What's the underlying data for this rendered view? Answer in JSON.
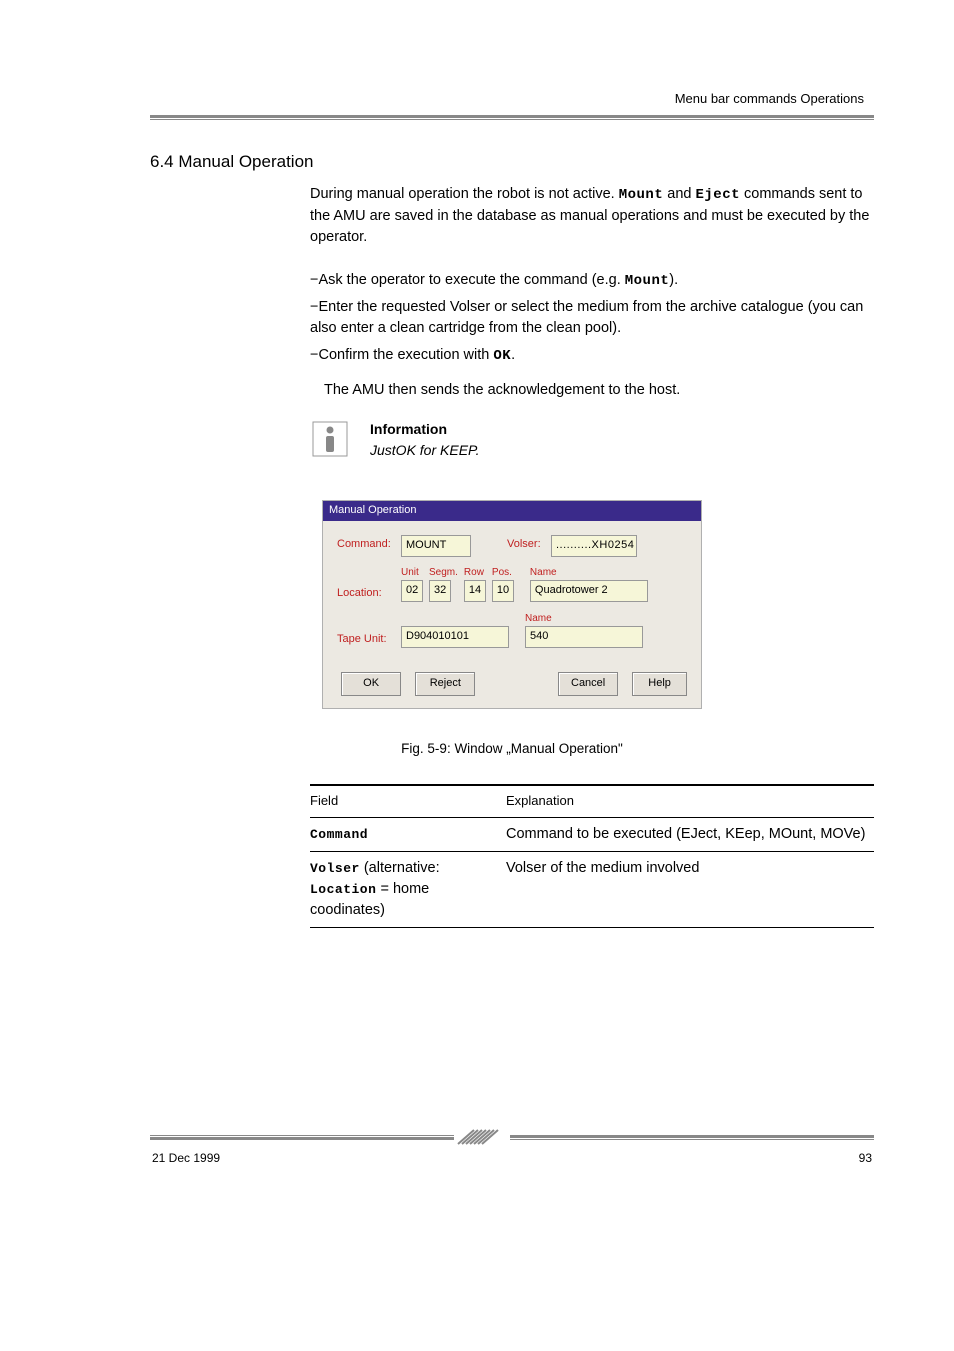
{
  "header": {
    "breadcrumb": "Menu bar commands Operations"
  },
  "section_title": "6.4 Manual Operation",
  "intro": {
    "p1_a": "During manual operation the robot is not active. ",
    "p1_mount": "Mount",
    "p1_b": " and ",
    "p1_eject": "Eject",
    "p1_c": " commands sent to the AMU are saved in the database as manual operations and must be executed by the operator.",
    "p2_a": "−Ask the operator to execute the command (e.g. ",
    "p2_mount2": "Mount",
    "p2_b": ").",
    "p3": "−Enter the requested Volser or select the medium from the archive catalogue (you can also enter a clean cartridge from the clean pool).",
    "p4_a": "−Confirm the execution with ",
    "p4_ok": "OK",
    "p4_b": ".",
    "p5": "The AMU then sends the acknowledgement to the host.",
    "note_head": "Information",
    "note_body": "JustOK for KEEP."
  },
  "dialog": {
    "title": "Manual Operation",
    "command_label": "Command:",
    "command_value": "MOUNT",
    "volser_label": "Volser:",
    "volser_value": "..........XH0254",
    "location_label": "Location:",
    "heads": {
      "unit": "Unit",
      "segm": "Segm.",
      "row": "Row",
      "pos": "Pos.",
      "name": "Name"
    },
    "loc_unit": "02",
    "loc_segm": "32",
    "loc_row": "14",
    "loc_pos": "10",
    "loc_name": "Quadrotower 2",
    "tape_label": "Tape Unit:",
    "tape_value": "D904010101",
    "tape_name": "540",
    "buttons": {
      "ok": "OK",
      "reject": "Reject",
      "cancel": "Cancel",
      "help": "Help"
    }
  },
  "fig_caption": "Fig. 5-9: Window „Manual Operation\"",
  "desc": {
    "head_field": "Field",
    "head_expl": "Explanation",
    "r1_field": "Command",
    "r1_expl": "Command to be executed (EJect, KEep, MOunt, MOVe)",
    "r2_a": "Volser",
    "r2_mid": " (alternative: ",
    "r2_loc": "Location",
    "r2_b": " = home coodinates)",
    "r2_expl": "Volser of the medium involved"
  },
  "footer": {
    "left": "21 Dec 1999",
    "right": "93"
  }
}
